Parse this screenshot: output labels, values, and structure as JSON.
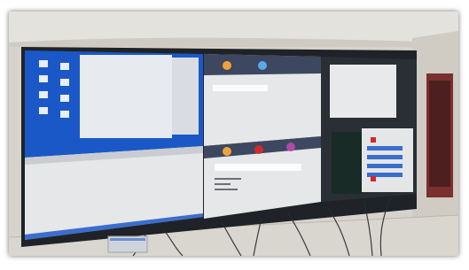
{
  "photo": {
    "colors": {
      "wall": "#d6d3cc",
      "floor": "#d9d5cf",
      "bezel": "#1f2328",
      "desktop_blue": "#1b58c7",
      "app_gray": "#e6e7e9",
      "window_white": "#eef0f2",
      "accent_red": "#d12a2a",
      "accent_orange": "#f1a23b"
    },
    "screen_text": {
      "top_left_icons": [
        "",
        "",
        "",
        "",
        "",
        "",
        "",
        ""
      ],
      "hdmi_list": [
        "",
        "",
        ""
      ],
      "menu_tabs": [
        "",
        "",
        ""
      ],
      "center_text": [
        "",
        "",
        "",
        ""
      ]
    }
  }
}
